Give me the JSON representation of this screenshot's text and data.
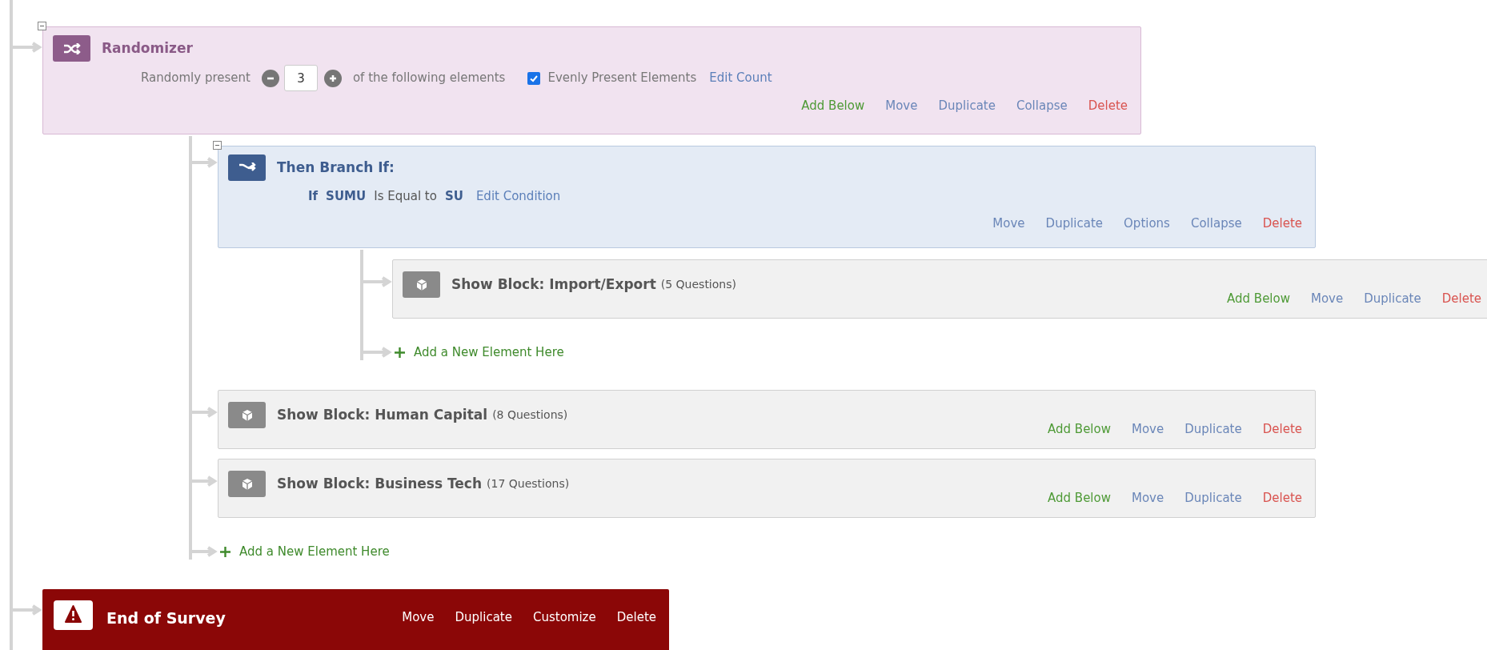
{
  "flow": [
    {
      "kind": "randomizer",
      "expanded": true,
      "title": "Randomizer",
      "present_label": "Randomly present",
      "count": "3",
      "following_label": "of the following elements",
      "evenly_present": {
        "label": "Evenly Present Elements",
        "checked": true
      },
      "edit_link": "Edit Count",
      "actions": [
        {
          "label": "Add Below",
          "kind": "add"
        },
        {
          "label": "Move",
          "kind": "link"
        },
        {
          "label": "Duplicate",
          "kind": "link"
        },
        {
          "label": "Collapse",
          "kind": "link"
        },
        {
          "label": "Delete",
          "kind": "delete"
        }
      ],
      "children": [
        {
          "kind": "branch",
          "expanded": true,
          "title": "Then Branch If:",
          "condition": {
            "prefix": "If",
            "field": "SUMU",
            "operator": "Is Equal to",
            "value": "SU",
            "edit_link": "Edit Condition"
          },
          "actions": [
            {
              "label": "Move",
              "kind": "link"
            },
            {
              "label": "Duplicate",
              "kind": "link"
            },
            {
              "label": "Options",
              "kind": "link"
            },
            {
              "label": "Collapse",
              "kind": "link"
            },
            {
              "label": "Delete",
              "kind": "delete"
            }
          ],
          "children": [
            {
              "kind": "block",
              "title": "Show Block: Import/Export",
              "count": "(5 Questions)",
              "actions": [
                {
                  "label": "Add Below",
                  "kind": "add"
                },
                {
                  "label": "Move",
                  "kind": "link"
                },
                {
                  "label": "Duplicate",
                  "kind": "link"
                },
                {
                  "label": "Delete",
                  "kind": "delete"
                }
              ]
            },
            {
              "kind": "add",
              "label": "Add a New Element Here"
            }
          ]
        },
        {
          "kind": "block",
          "title": "Show Block: Human Capital",
          "count": "(8 Questions)",
          "actions": [
            {
              "label": "Add Below",
              "kind": "add"
            },
            {
              "label": "Move",
              "kind": "link"
            },
            {
              "label": "Duplicate",
              "kind": "link"
            },
            {
              "label": "Delete",
              "kind": "delete"
            }
          ]
        },
        {
          "kind": "block",
          "title": "Show Block: Business Tech",
          "count": "(17 Questions)",
          "actions": [
            {
              "label": "Add Below",
              "kind": "add"
            },
            {
              "label": "Move",
              "kind": "link"
            },
            {
              "label": "Duplicate",
              "kind": "link"
            },
            {
              "label": "Delete",
              "kind": "delete"
            }
          ]
        },
        {
          "kind": "add",
          "label": "Add a New Element Here"
        }
      ]
    },
    {
      "kind": "end",
      "title": "End of Survey",
      "actions": [
        {
          "label": "Move"
        },
        {
          "label": "Duplicate"
        },
        {
          "label": "Customize"
        },
        {
          "label": "Delete"
        }
      ]
    }
  ]
}
